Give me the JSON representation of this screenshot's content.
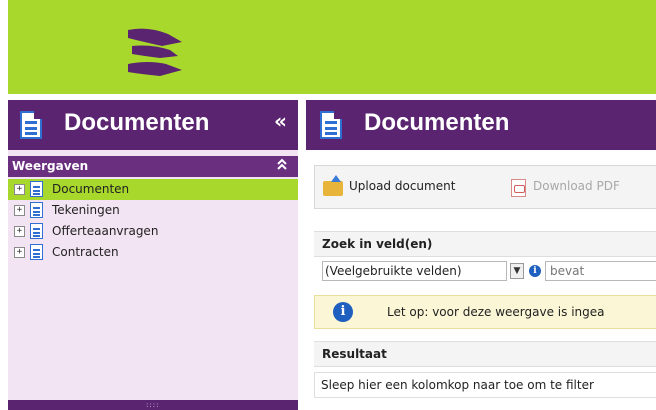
{
  "brand": {
    "accent": "#a8d82c",
    "panel_header": "#5b2470",
    "panel_bg": "#f3e4f3"
  },
  "left_panel": {
    "title": "Documenten",
    "collapse_label": "«",
    "section": {
      "title": "Weergaven",
      "toggle": "≈"
    },
    "items": [
      {
        "label": "Documenten",
        "selected": true
      },
      {
        "label": "Tekeningen",
        "selected": false
      },
      {
        "label": "Offerteaanvragen",
        "selected": false
      },
      {
        "label": "Contracten",
        "selected": false
      }
    ],
    "footer_grip": "::::"
  },
  "main_panel": {
    "title": "Documenten",
    "toolbar": {
      "upload_label": "Upload document",
      "download_label": "Download PDF"
    },
    "search": {
      "section_title": "Zoek in veld(en)",
      "field_select_value": "(Veelgebruikte velden)",
      "dropdown_arrow": "▼",
      "info_glyph": "i",
      "operator_placeholder": "bevat"
    },
    "notice": {
      "info_glyph": "i",
      "text": "Let op: voor deze weergave is ingea"
    },
    "result": {
      "section_title": "Resultaat",
      "group_hint": "Sleep hier een kolomkop naar toe om te filter"
    }
  }
}
